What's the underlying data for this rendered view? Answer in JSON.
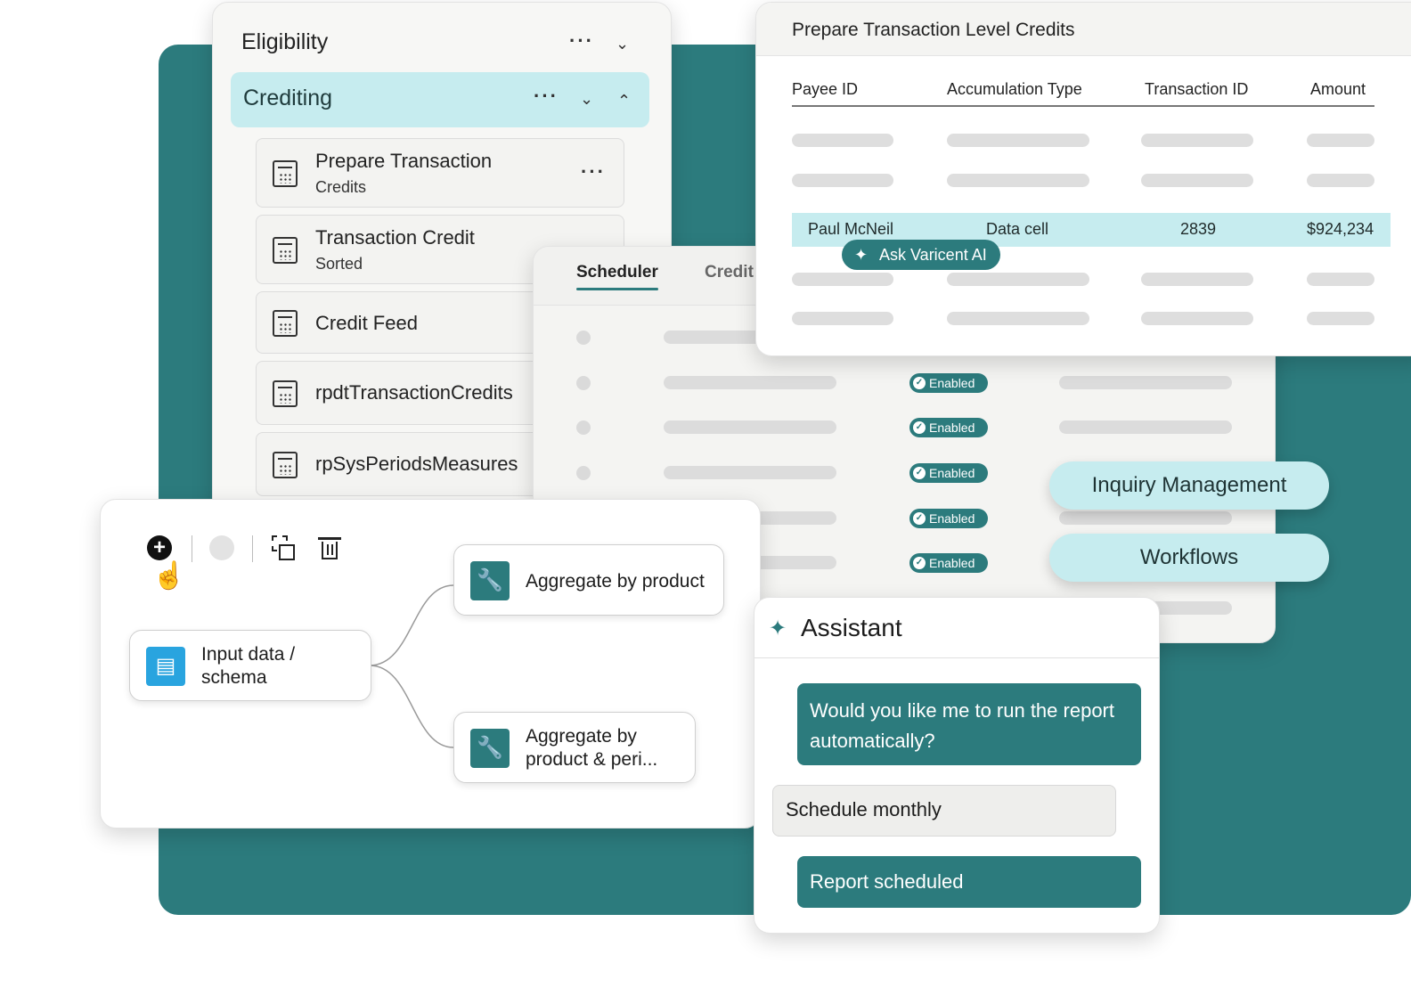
{
  "colors": {
    "teal": "#2c7b7d",
    "light_teal": "#c6ecef",
    "highlight": "#c6ecef"
  },
  "eligibility": {
    "title": "Eligibility",
    "crediting_label": "Crediting",
    "items": [
      {
        "title": "Prepare Transaction",
        "subtitle": "Credits"
      },
      {
        "title": "Transaction Credit",
        "subtitle": "Sorted"
      },
      {
        "title": "Credit Feed",
        "subtitle": ""
      },
      {
        "title": "rpdtTransactionCredits",
        "subtitle": ""
      },
      {
        "title": "rpSysPeriodsMeasures",
        "subtitle": ""
      }
    ]
  },
  "scheduler": {
    "tabs": [
      "Scheduler",
      "Credit"
    ],
    "status": "Enabled"
  },
  "transactions": {
    "title": "Prepare Transaction Level Credits",
    "columns": [
      "Payee ID",
      "Accumulation Type",
      "Transaction ID",
      "Amount"
    ],
    "highlighted_row": {
      "payee": "Paul McNeil",
      "type": "Data cell",
      "id": "2839",
      "amount": "$924,234"
    },
    "ai_button": "Ask Varicent AI"
  },
  "pills": {
    "inquiry": "Inquiry Management",
    "workflows": "Workflows"
  },
  "flow": {
    "input_node": "Input data / schema",
    "node_1": "Aggregate by product",
    "node_2": "Aggregate by product & peri..."
  },
  "assistant": {
    "title": "Assistant",
    "bot_question": "Would you like me to run the  report automatically?",
    "user_reply": "Schedule monthly",
    "bot_confirm": "Report scheduled"
  }
}
